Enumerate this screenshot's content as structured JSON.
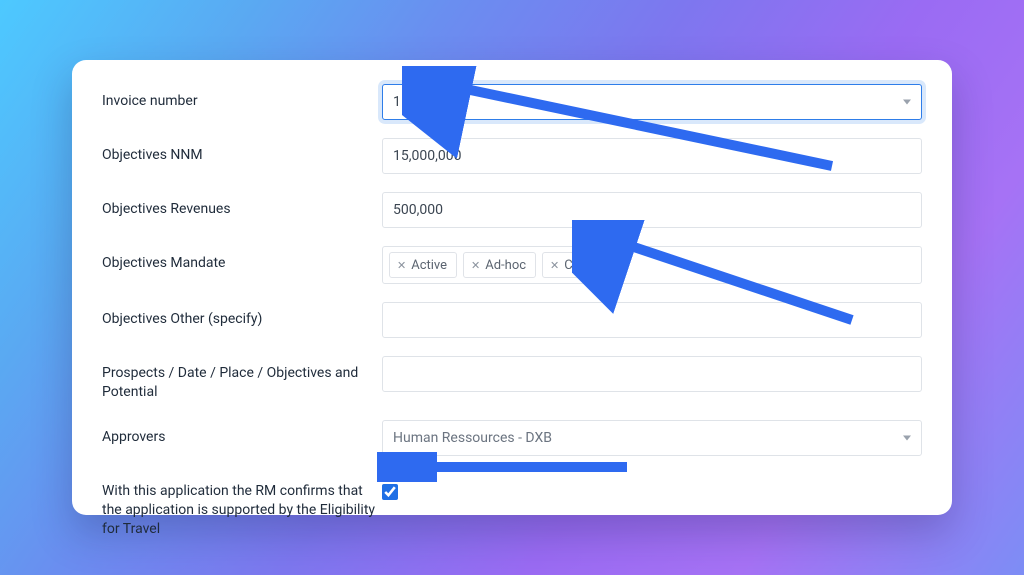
{
  "labels": {
    "invoice_number": "Invoice number",
    "objectives_nnm": "Objectives NNM",
    "objectives_revenues": "Objectives Revenues",
    "objectives_mandate": "Objectives Mandate",
    "objectives_other": "Objectives Other (specify)",
    "prospects": "Prospects / Date / Place / Objectives and Potential",
    "approvers": "Approvers",
    "confirmation": "With this application the RM confirms that the application is supported by the Eligibility for Travel"
  },
  "values": {
    "invoice_number": "1121",
    "objectives_nnm": "15,000,000",
    "objectives_revenues": "500,000",
    "objectives_other": "",
    "prospects": "",
    "approvers": "Human Ressources - DXB",
    "confirmation_checked": true
  },
  "mandate_tags": [
    {
      "label": "Active"
    },
    {
      "label": "Ad-hoc"
    },
    {
      "label": "Classic"
    }
  ],
  "annotations": {
    "arrow_color": "#2e6af0"
  }
}
